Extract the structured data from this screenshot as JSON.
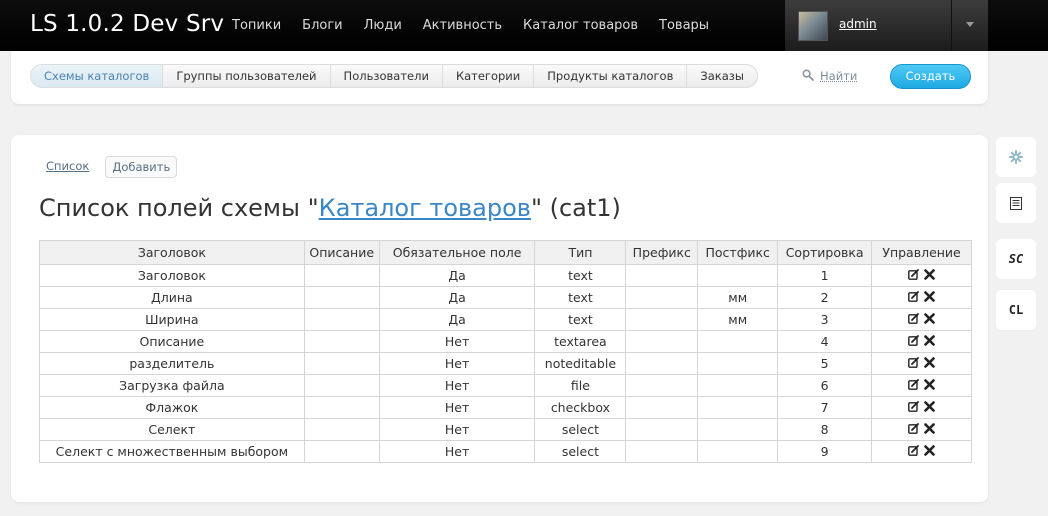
{
  "site_title": "LS 1.0.2 Dev Srv",
  "nav": [
    "Топики",
    "Блоги",
    "Люди",
    "Активность",
    "Каталог товаров",
    "Товары"
  ],
  "user": {
    "name": "admin"
  },
  "tabs": [
    "Схемы каталогов",
    "Группы пользователей",
    "Пользователи",
    "Категории",
    "Продукты каталогов",
    "Заказы"
  ],
  "active_tab": 0,
  "search_label": "Найти",
  "create_label": "Создать",
  "actions": {
    "list": "Список",
    "add": "Добавить"
  },
  "heading": {
    "prefix": "Список полей схемы \"",
    "link": "Каталог товаров",
    "suffix": "\" (cat1)"
  },
  "table": {
    "columns": [
      "Заголовок",
      "Описание",
      "Обязательное поле",
      "Тип",
      "Префикс",
      "Постфикс",
      "Сортировка",
      "Управление"
    ],
    "rows": [
      {
        "title": "Заголовок",
        "description": "",
        "required": "Да",
        "type": "text",
        "prefix": "",
        "postfix": "",
        "sort": "1"
      },
      {
        "title": "Длина",
        "description": "",
        "required": "Да",
        "type": "text",
        "prefix": "",
        "postfix": "мм",
        "sort": "2"
      },
      {
        "title": "Ширина",
        "description": "",
        "required": "Да",
        "type": "text",
        "prefix": "",
        "postfix": "мм",
        "sort": "3"
      },
      {
        "title": "Описание",
        "description": "",
        "required": "Нет",
        "type": "textarea",
        "prefix": "",
        "postfix": "",
        "sort": "4"
      },
      {
        "title": "разделитель",
        "description": "",
        "required": "Нет",
        "type": "noteditable",
        "prefix": "",
        "postfix": "",
        "sort": "5"
      },
      {
        "title": "Загрузка файла",
        "description": "",
        "required": "Нет",
        "type": "file",
        "prefix": "",
        "postfix": "",
        "sort": "6"
      },
      {
        "title": "Флажок",
        "description": "",
        "required": "Нет",
        "type": "checkbox",
        "prefix": "",
        "postfix": "",
        "sort": "7"
      },
      {
        "title": "Селект",
        "description": "",
        "required": "Нет",
        "type": "select",
        "prefix": "",
        "postfix": "",
        "sort": "8"
      },
      {
        "title": "Селект с множественным выбором",
        "description": "",
        "required": "Нет",
        "type": "select",
        "prefix": "",
        "postfix": "",
        "sort": "9"
      }
    ]
  },
  "row_action_icons": [
    "edit-icon",
    "delete-icon"
  ],
  "right_tools": [
    {
      "icon": "gear-icon",
      "label": ""
    },
    {
      "icon": "document-icon",
      "label": ""
    },
    {
      "icon": "sc-icon",
      "label": "SC"
    },
    {
      "icon": "cl-icon",
      "label": "CL"
    }
  ],
  "colors": {
    "accent": "#3b86c4",
    "create_button": "#29b4ea",
    "topbar": "#000000"
  }
}
